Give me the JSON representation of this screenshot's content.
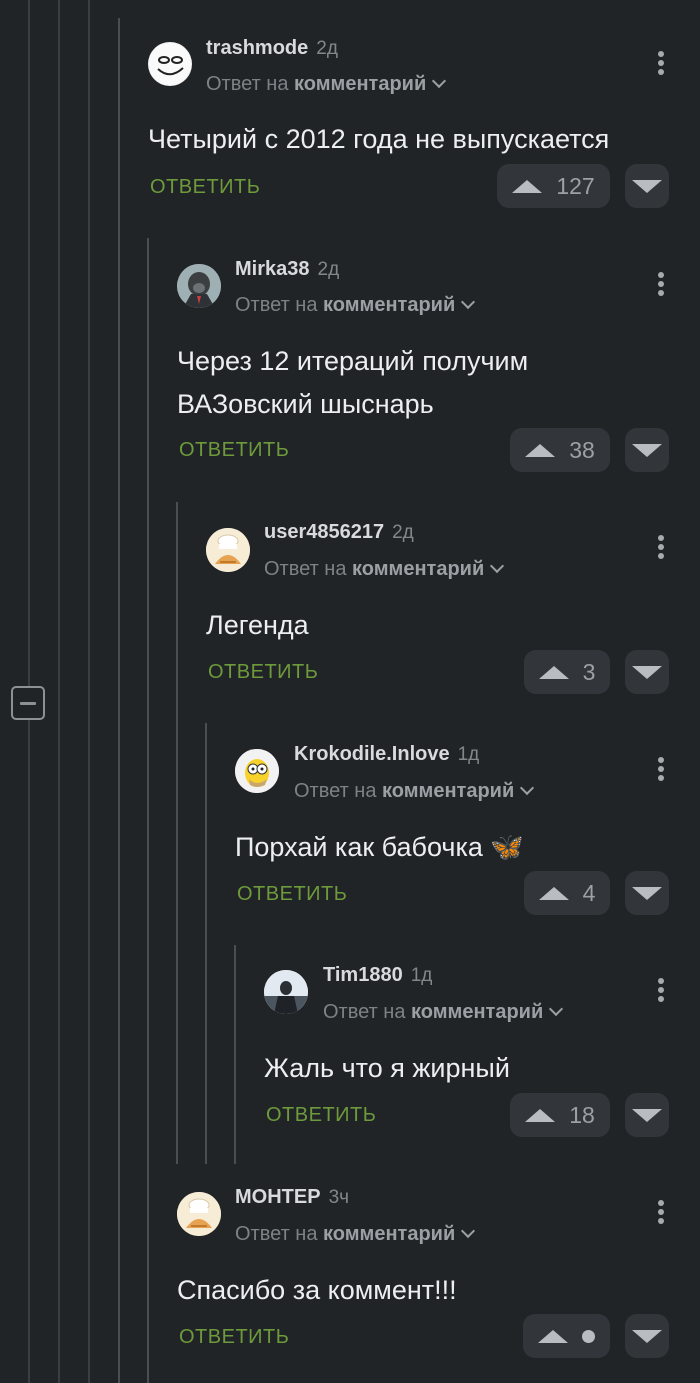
{
  "comments": [
    {
      "user": "trashmode",
      "time": "2д",
      "reply_prefix": "Ответ на",
      "reply_target": "комментарий",
      "text": "Четырий с 2012 года не выпускается",
      "reply_label": "ОТВЕТИТЬ",
      "rating": "127",
      "avatar_icon": "troll-face-avatar"
    },
    {
      "user": "Mirka38",
      "time": "2д",
      "reply_prefix": "Ответ на",
      "reply_target": "комментарий",
      "text_line1": "Через 12 итераций получим",
      "text_line2": "ВАЗовский шыснарь",
      "reply_label": "ОТВЕТИТЬ",
      "rating": "38",
      "avatar_icon": "gorilla-suit-avatar"
    },
    {
      "user": "user4856217",
      "time": "2д",
      "reply_prefix": "Ответ на",
      "reply_target": "комментарий",
      "text": "Легенда",
      "reply_label": "ОТВЕТИТЬ",
      "rating": "3",
      "avatar_icon": "chef-bread-avatar"
    },
    {
      "user": "Krokodile.Inlove",
      "time": "1д",
      "reply_prefix": "Ответ на",
      "reply_target": "комментарий",
      "text": "Порхай как бабочка 🦋",
      "reply_label": "ОТВЕТИТЬ",
      "rating": "4",
      "avatar_icon": "homer-avatar"
    },
    {
      "user": "Tim1880",
      "time": "1д",
      "reply_prefix": "Ответ на",
      "reply_target": "комментарий",
      "text": "Жаль что я жирный",
      "reply_label": "ОТВЕТИТЬ",
      "rating": "18",
      "avatar_icon": "photo-avatar"
    },
    {
      "user": "МОНТЕР",
      "time": "3ч",
      "reply_prefix": "Ответ на",
      "reply_target": "комментарий",
      "text": "Спасибо за коммент!!!",
      "reply_label": "ОТВЕТИТЬ",
      "rating": "",
      "avatar_icon": "chef-bread-avatar"
    }
  ],
  "icons": {
    "collapse": "collapse-thread-icon",
    "more": "more-vertical-icon",
    "upvote": "upvote-icon",
    "downvote": "downvote-icon",
    "chevron": "chevron-down-icon"
  },
  "colors": {
    "background": "#212427",
    "accent_reply": "#6d9a3b",
    "vote_button": "#323539"
  }
}
